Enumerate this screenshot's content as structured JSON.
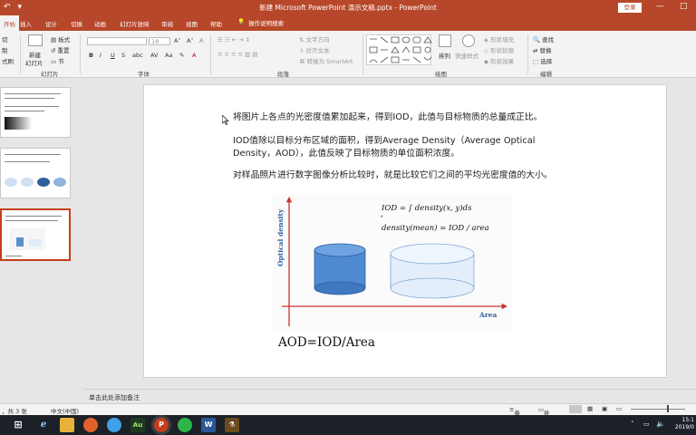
{
  "window": {
    "title": "新建 Microsoft PowerPoint 演示文稿.pptx - PowerPoint",
    "login_label": "登录",
    "minimize_glyph": "—",
    "maximize_glyph": "□"
  },
  "ribbon_tabs": [
    {
      "label": "开始",
      "active": true
    },
    {
      "label": "插入"
    },
    {
      "label": "设计"
    },
    {
      "label": "切换"
    },
    {
      "label": "动画"
    },
    {
      "label": "幻灯片放映"
    },
    {
      "label": "审阅"
    },
    {
      "label": "视图"
    },
    {
      "label": "帮助"
    }
  ],
  "tell_me": "操作说明搜索",
  "ribbon": {
    "clipboard_cut": "切",
    "clipboard_copy": "制",
    "clipboard_format": "式刷",
    "new_slide_label_1": "新建",
    "new_slide_label_2": "幻灯片",
    "slides_group": "幻灯片",
    "layout": "板式",
    "reset": "重置",
    "section": "节",
    "font_size": "18",
    "font_group": "字体",
    "paragraph_group": "段落",
    "text_direction": "文字方向",
    "align_text": "对齐文本",
    "convert_smartart": "转换为 SmartArt",
    "drawing_group": "绘图",
    "arrange": "排列",
    "quick_styles": "快速样式",
    "shape_fill": "形状填充",
    "shape_outline": "形状轮廓",
    "shape_effects": "形状效果",
    "find": "查找",
    "replace": "替换",
    "select": "选择",
    "editing_group": "编辑",
    "bold": "B",
    "italic": "I",
    "underline": "U",
    "strike": "S",
    "abc": "abc"
  },
  "slide": {
    "para1": "将图片上各点的光密度值累加起来，得到IOD，此值与目标物质的总量成正比。",
    "para2": "IOD值除以目标分布区域的面积，得到Average Density（Average Optical Density，AOD），此值反映了目标物质的单位面积浓度。",
    "para3": "对样品照片进行数字图像分析比较时，就是比较它们之间的平均光密度值的大小。",
    "fig_ylabel": "Optical density",
    "fig_xlabel": "Area",
    "formula1": "IOD = ∫ density(x, y)ds",
    "formula_sub": "s",
    "formula2": "density(mean) = IOD / area",
    "aod_text": "AOD=IOD/Area"
  },
  "notes_placeholder": "单击此处添加备注",
  "status": {
    "slide_count": "，共 3 张",
    "language": "中文(中国)",
    "notes_btn": "备注",
    "comments_btn": "批注"
  },
  "clock": {
    "time": "15:1",
    "date": "2019/0"
  }
}
